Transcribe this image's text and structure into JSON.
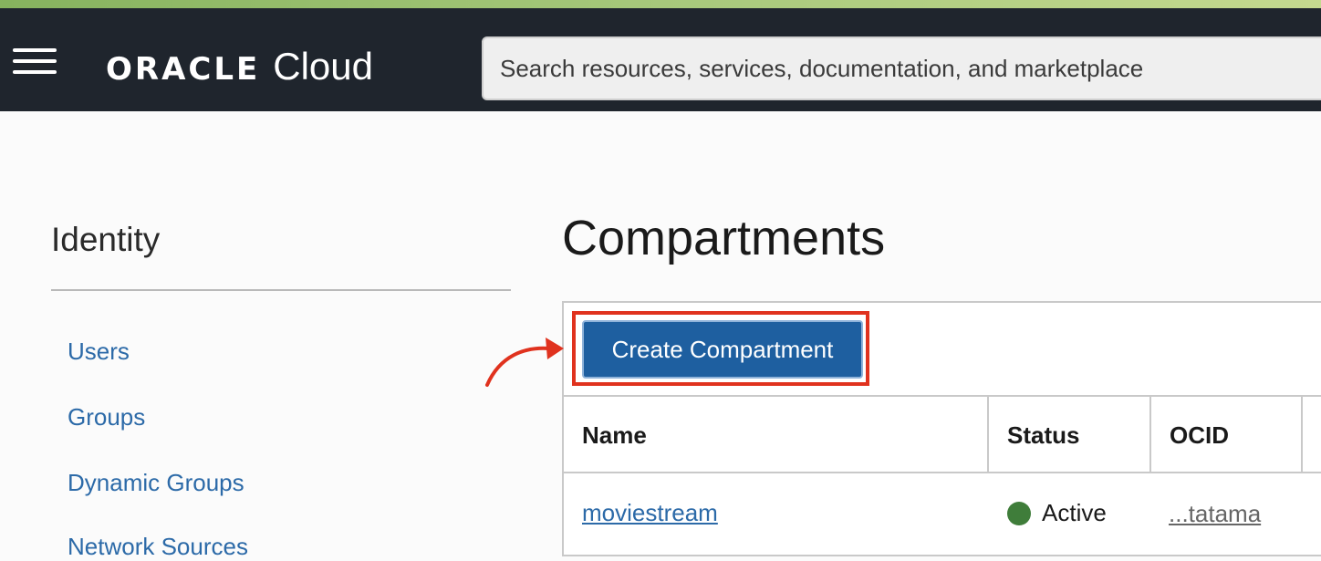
{
  "header": {
    "brand": "ORACLE",
    "product": "Cloud",
    "search_placeholder": "Search resources, services, documentation, and marketplace"
  },
  "sidebar": {
    "title": "Identity",
    "items": [
      {
        "label": "Users"
      },
      {
        "label": "Groups"
      },
      {
        "label": "Dynamic Groups"
      },
      {
        "label": "Network Sources"
      }
    ]
  },
  "main": {
    "title": "Compartments",
    "create_button_label": "Create Compartment",
    "table": {
      "columns": [
        "Name",
        "Status",
        "OCID"
      ],
      "rows": [
        {
          "name": "moviestream",
          "status": "Active",
          "ocid": "...tatama"
        }
      ]
    }
  },
  "colors": {
    "header_bg": "#1f252d",
    "accent_button": "#1e5fa0",
    "link": "#2c6aa8",
    "highlight": "#e0321e",
    "status_active": "#3f7d3a"
  }
}
